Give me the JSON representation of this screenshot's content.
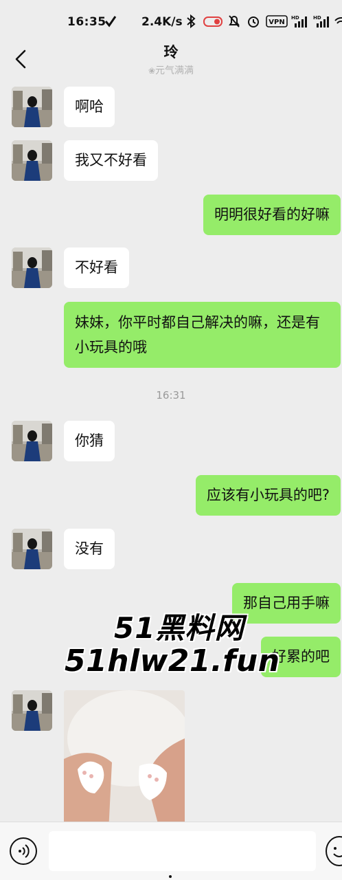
{
  "status_bar": {
    "time": "16:35",
    "network_speed": "2.4K/s",
    "vpn_label": "VPN",
    "hd_label": "HD"
  },
  "header": {
    "contact_name": "玲",
    "contact_status": "元气满满"
  },
  "messages": [
    {
      "side": "in",
      "text": "啊哈"
    },
    {
      "side": "in",
      "text": "我又不好看"
    },
    {
      "side": "out",
      "text": "明明很好看的好嘛"
    },
    {
      "side": "in",
      "text": "不好看"
    },
    {
      "side": "out",
      "text": "妹妹，你平时都自己解决的嘛，还是有小玩具的哦"
    },
    {
      "side": "in",
      "text": "你猜"
    },
    {
      "side": "out",
      "text": "应该有小玩具的吧?"
    },
    {
      "side": "in",
      "text": "没有"
    },
    {
      "side": "out",
      "text": "那自己用手嘛"
    },
    {
      "side": "out",
      "text": "好累的吧"
    }
  ],
  "timestamp": "16:31",
  "watermark": {
    "line1": "51黑料网",
    "line2": "51hlw21.fun"
  },
  "input": {
    "value": "",
    "placeholder": ""
  },
  "icons": {
    "back": "chevron-left-icon",
    "voice": "voice-icon",
    "emoji": "emoji-icon",
    "status_leaf": "paw-icon"
  },
  "colors": {
    "background": "#ededed",
    "outgoing_bubble": "#95ec69",
    "incoming_bubble": "#ffffff"
  }
}
